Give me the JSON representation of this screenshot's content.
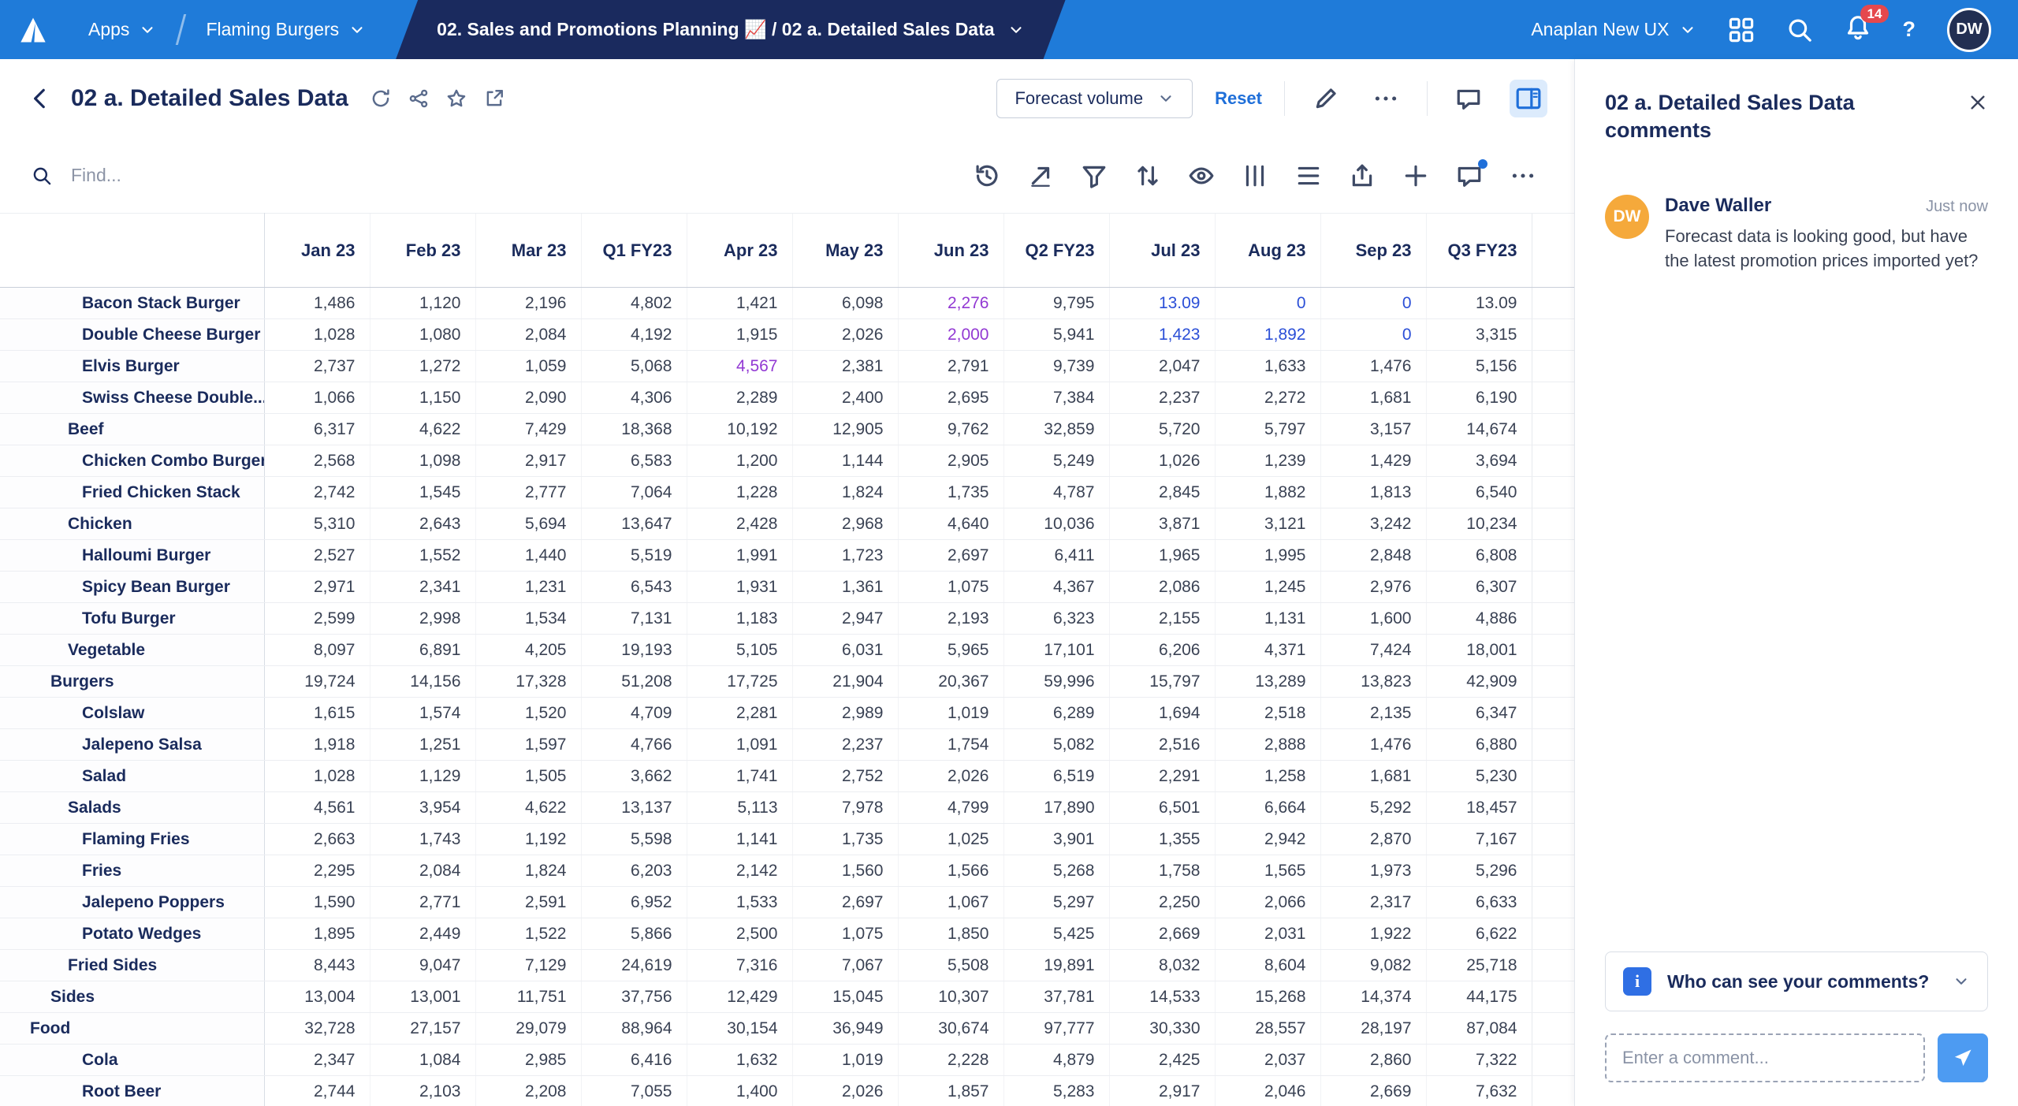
{
  "topnav": {
    "apps_label": "Apps",
    "workspace_label": "Flaming Burgers",
    "breadcrumb": "02. Sales and Promotions Planning 📈 / 02 a. Detailed Sales Data",
    "env_label": "Anaplan New UX",
    "notification_count": "14",
    "help_label": "?",
    "avatar_initials": "DW"
  },
  "header": {
    "title": "02 a. Detailed Sales Data",
    "view_selector": "Forecast volume",
    "reset_label": "Reset"
  },
  "toolbar": {
    "find_placeholder": "Find..."
  },
  "icons": {
    "topnav": [
      "anaplan-logo",
      "chevron-down-icon",
      "models-icon",
      "search-icon",
      "bell-icon",
      "help-icon",
      "avatar"
    ],
    "page_header": [
      "back-icon",
      "sync-icon",
      "share-icon",
      "star-icon",
      "open-external-icon",
      "pencil-icon",
      "ellipsis-icon",
      "comment-icon",
      "panel-right-icon"
    ],
    "toolbar": [
      "search-icon",
      "history-icon",
      "jump-to-icon",
      "filter-icon",
      "sort-icon",
      "eye-icon",
      "freeze-columns-icon",
      "rows-icon",
      "export-icon",
      "plus-icon",
      "comment-icon",
      "ellipsis-icon"
    ],
    "comments_panel": [
      "close-icon",
      "info-icon",
      "chevron-down-icon",
      "send-icon"
    ]
  },
  "colors": {
    "nav_blue": "#1F7BD9",
    "tab_navy": "#1A2A5E",
    "accent_blue": "#1F6FD9",
    "cell_edited_purple": "#9239D3",
    "cell_forecast_blue": "#2B4FD7",
    "avatar_orange": "#F5A93B",
    "badge_red": "#E5484D"
  },
  "grid": {
    "columns": [
      "Jan 23",
      "Feb 23",
      "Mar 23",
      "Q1 FY23",
      "Apr 23",
      "May 23",
      "Jun 23",
      "Q2 FY23",
      "Jul 23",
      "Aug 23",
      "Sep 23",
      "Q3 FY23"
    ],
    "rows": [
      {
        "label": "Bacon Stack Burger",
        "level": 3,
        "parent": false,
        "values": [
          "1,486",
          "1,120",
          "2,196",
          "4,802",
          "1,421",
          "6,098",
          "2,276",
          "9,795",
          "13.09",
          "0",
          "0",
          "13.09"
        ],
        "cell_colors": {
          "6": "purple",
          "8": "blue",
          "9": "blue",
          "10": "blue"
        }
      },
      {
        "label": "Double Cheese Burger",
        "level": 3,
        "parent": false,
        "values": [
          "1,028",
          "1,080",
          "2,084",
          "4,192",
          "1,915",
          "2,026",
          "2,000",
          "5,941",
          "1,423",
          "1,892",
          "0",
          "3,315"
        ],
        "cell_colors": {
          "6": "purple",
          "8": "blue",
          "9": "blue",
          "10": "blue"
        }
      },
      {
        "label": "Elvis Burger",
        "level": 3,
        "parent": false,
        "values": [
          "2,737",
          "1,272",
          "1,059",
          "5,068",
          "4,567",
          "2,381",
          "2,791",
          "9,739",
          "2,047",
          "1,633",
          "1,476",
          "5,156"
        ],
        "cell_colors": {
          "4": "purple"
        }
      },
      {
        "label": "Swiss Cheese Double...",
        "level": 3,
        "parent": false,
        "values": [
          "1,066",
          "1,150",
          "2,090",
          "4,306",
          "2,289",
          "2,400",
          "2,695",
          "7,384",
          "2,237",
          "2,272",
          "1,681",
          "6,190"
        ]
      },
      {
        "label": "Beef",
        "level": 2,
        "parent": true,
        "values": [
          "6,317",
          "4,622",
          "7,429",
          "18,368",
          "10,192",
          "12,905",
          "9,762",
          "32,859",
          "5,720",
          "5,797",
          "3,157",
          "14,674"
        ]
      },
      {
        "label": "Chicken Combo Burger",
        "level": 3,
        "parent": false,
        "values": [
          "2,568",
          "1,098",
          "2,917",
          "6,583",
          "1,200",
          "1,144",
          "2,905",
          "5,249",
          "1,026",
          "1,239",
          "1,429",
          "3,694"
        ]
      },
      {
        "label": "Fried Chicken Stack",
        "level": 3,
        "parent": false,
        "values": [
          "2,742",
          "1,545",
          "2,777",
          "7,064",
          "1,228",
          "1,824",
          "1,735",
          "4,787",
          "2,845",
          "1,882",
          "1,813",
          "6,540"
        ]
      },
      {
        "label": "Chicken",
        "level": 2,
        "parent": true,
        "values": [
          "5,310",
          "2,643",
          "5,694",
          "13,647",
          "2,428",
          "2,968",
          "4,640",
          "10,036",
          "3,871",
          "3,121",
          "3,242",
          "10,234"
        ]
      },
      {
        "label": "Halloumi Burger",
        "level": 3,
        "parent": false,
        "values": [
          "2,527",
          "1,552",
          "1,440",
          "5,519",
          "1,991",
          "1,723",
          "2,697",
          "6,411",
          "1,965",
          "1,995",
          "2,848",
          "6,808"
        ]
      },
      {
        "label": "Spicy Bean Burger",
        "level": 3,
        "parent": false,
        "values": [
          "2,971",
          "2,341",
          "1,231",
          "6,543",
          "1,931",
          "1,361",
          "1,075",
          "4,367",
          "2,086",
          "1,245",
          "2,976",
          "6,307"
        ]
      },
      {
        "label": "Tofu Burger",
        "level": 3,
        "parent": false,
        "values": [
          "2,599",
          "2,998",
          "1,534",
          "7,131",
          "1,183",
          "2,947",
          "2,193",
          "6,323",
          "2,155",
          "1,131",
          "1,600",
          "4,886"
        ]
      },
      {
        "label": "Vegetable",
        "level": 2,
        "parent": true,
        "values": [
          "8,097",
          "6,891",
          "4,205",
          "19,193",
          "5,105",
          "6,031",
          "5,965",
          "17,101",
          "6,206",
          "4,371",
          "7,424",
          "18,001"
        ]
      },
      {
        "label": "Burgers",
        "level": 1,
        "parent": true,
        "values": [
          "19,724",
          "14,156",
          "17,328",
          "51,208",
          "17,725",
          "21,904",
          "20,367",
          "59,996",
          "15,797",
          "13,289",
          "13,823",
          "42,909"
        ]
      },
      {
        "label": "Colslaw",
        "level": 3,
        "parent": false,
        "values": [
          "1,615",
          "1,574",
          "1,520",
          "4,709",
          "2,281",
          "2,989",
          "1,019",
          "6,289",
          "1,694",
          "2,518",
          "2,135",
          "6,347"
        ]
      },
      {
        "label": "Jalepeno Salsa",
        "level": 3,
        "parent": false,
        "values": [
          "1,918",
          "1,251",
          "1,597",
          "4,766",
          "1,091",
          "2,237",
          "1,754",
          "5,082",
          "2,516",
          "2,888",
          "1,476",
          "6,880"
        ]
      },
      {
        "label": "Salad",
        "level": 3,
        "parent": false,
        "values": [
          "1,028",
          "1,129",
          "1,505",
          "3,662",
          "1,741",
          "2,752",
          "2,026",
          "6,519",
          "2,291",
          "1,258",
          "1,681",
          "5,230"
        ]
      },
      {
        "label": "Salads",
        "level": 2,
        "parent": true,
        "values": [
          "4,561",
          "3,954",
          "4,622",
          "13,137",
          "5,113",
          "7,978",
          "4,799",
          "17,890",
          "6,501",
          "6,664",
          "5,292",
          "18,457"
        ]
      },
      {
        "label": "Flaming Fries",
        "level": 3,
        "parent": false,
        "values": [
          "2,663",
          "1,743",
          "1,192",
          "5,598",
          "1,141",
          "1,735",
          "1,025",
          "3,901",
          "1,355",
          "2,942",
          "2,870",
          "7,167"
        ]
      },
      {
        "label": "Fries",
        "level": 3,
        "parent": false,
        "values": [
          "2,295",
          "2,084",
          "1,824",
          "6,203",
          "2,142",
          "1,560",
          "1,566",
          "5,268",
          "1,758",
          "1,565",
          "1,973",
          "5,296"
        ]
      },
      {
        "label": "Jalepeno Poppers",
        "level": 3,
        "parent": false,
        "values": [
          "1,590",
          "2,771",
          "2,591",
          "6,952",
          "1,533",
          "2,697",
          "1,067",
          "5,297",
          "2,250",
          "2,066",
          "2,317",
          "6,633"
        ]
      },
      {
        "label": "Potato Wedges",
        "level": 3,
        "parent": false,
        "values": [
          "1,895",
          "2,449",
          "1,522",
          "5,866",
          "2,500",
          "1,075",
          "1,850",
          "5,425",
          "2,669",
          "2,031",
          "1,922",
          "6,622"
        ]
      },
      {
        "label": "Fried Sides",
        "level": 2,
        "parent": true,
        "values": [
          "8,443",
          "9,047",
          "7,129",
          "24,619",
          "7,316",
          "7,067",
          "5,508",
          "19,891",
          "8,032",
          "8,604",
          "9,082",
          "25,718"
        ]
      },
      {
        "label": "Sides",
        "level": 1,
        "parent": true,
        "values": [
          "13,004",
          "13,001",
          "11,751",
          "37,756",
          "12,429",
          "15,045",
          "10,307",
          "37,781",
          "14,533",
          "15,268",
          "14,374",
          "44,175"
        ]
      },
      {
        "label": "Food",
        "level": 0,
        "parent": true,
        "values": [
          "32,728",
          "27,157",
          "29,079",
          "88,964",
          "30,154",
          "36,949",
          "30,674",
          "97,777",
          "30,330",
          "28,557",
          "28,197",
          "87,084"
        ]
      },
      {
        "label": "Cola",
        "level": 3,
        "parent": false,
        "values": [
          "2,347",
          "1,084",
          "2,985",
          "6,416",
          "1,632",
          "1,019",
          "2,228",
          "4,879",
          "2,425",
          "2,037",
          "2,860",
          "7,322"
        ]
      },
      {
        "label": "Root Beer",
        "level": 3,
        "parent": false,
        "values": [
          "2,744",
          "2,103",
          "2,208",
          "7,055",
          "1,400",
          "2,026",
          "1,857",
          "5,283",
          "2,917",
          "2,046",
          "2,669",
          "7,632"
        ]
      }
    ]
  },
  "comments": {
    "title": "02 a. Detailed Sales Data comments",
    "comment": {
      "initials": "DW",
      "author": "Dave Waller",
      "time": "Just now",
      "text": "Forecast data is looking good, but have the latest promotion prices imported yet?"
    },
    "visibility_label": "Who can see your comments?",
    "input_placeholder": "Enter a comment..."
  }
}
